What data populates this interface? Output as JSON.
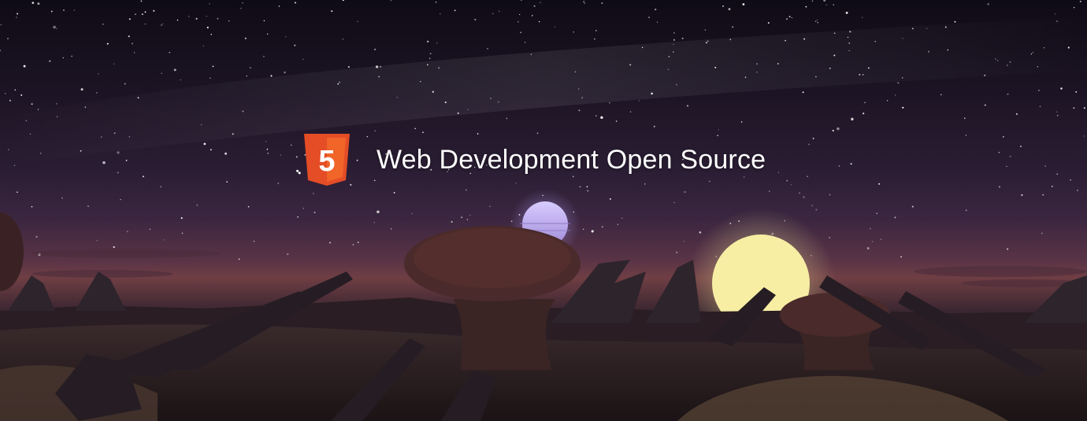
{
  "banner": {
    "logo_icon": "html5-logo-icon",
    "logo_label": "5",
    "headline": "Web Development Open Source",
    "colors": {
      "logo_orange": "#E44D26",
      "logo_orange_light": "#F16529",
      "headline_text": "#FFFFFF",
      "moon_small": "#C9B8F0",
      "moon_large": "#F6EDA2"
    }
  }
}
